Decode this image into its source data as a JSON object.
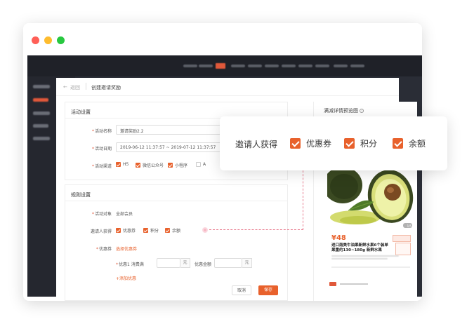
{
  "window": {
    "controls": [
      "close",
      "minimize",
      "maximize"
    ]
  },
  "header": {
    "back_label": "返回",
    "title": "创建邀请奖励"
  },
  "activity_section": {
    "title": "活动设置",
    "name_label": "活动名称",
    "name_value": "邀请奖励2.2",
    "date_label": "活动日期",
    "date_value": "2019-06-12 11:37:57 ~ 2019-07-12 11:37:57",
    "channel_label": "活动渠道",
    "channels": [
      {
        "label": "H5",
        "checked": true
      },
      {
        "label": "微信公众号",
        "checked": true
      },
      {
        "label": "小程序",
        "checked": true
      },
      {
        "label": "A",
        "checked": false
      }
    ]
  },
  "rules_section": {
    "title": "规则设置",
    "target_label": "活动对象",
    "target_value": "全部会员",
    "reward_label": "邀请人获得",
    "rewards": [
      {
        "label": "优惠券",
        "checked": true
      },
      {
        "label": "积分",
        "checked": true
      },
      {
        "label": "余额",
        "checked": true
      }
    ],
    "coupon_label": "优惠券",
    "coupon_link": "选择优惠券",
    "offer_label": "优惠1 消费满",
    "offer_unit": "元",
    "discount_label": "优惠金额",
    "discount_unit": "元",
    "add_offer": "+添加优惠"
  },
  "actions": {
    "cancel": "取消",
    "save": "保存"
  },
  "preview": {
    "title": "满减详情预览图",
    "price": "¥48",
    "product_name": "进口南美牛油果新鲜水果6个装单果重约130~180g 新鲜水果",
    "image_counter": "1/5"
  },
  "callout": {
    "label": "邀请人获得",
    "options": [
      {
        "label": "优惠券",
        "checked": true
      },
      {
        "label": "积分",
        "checked": true
      },
      {
        "label": "余额",
        "checked": true
      }
    ]
  },
  "colors": {
    "accent": "#e8612c",
    "dark_bg": "#2a2d36"
  }
}
